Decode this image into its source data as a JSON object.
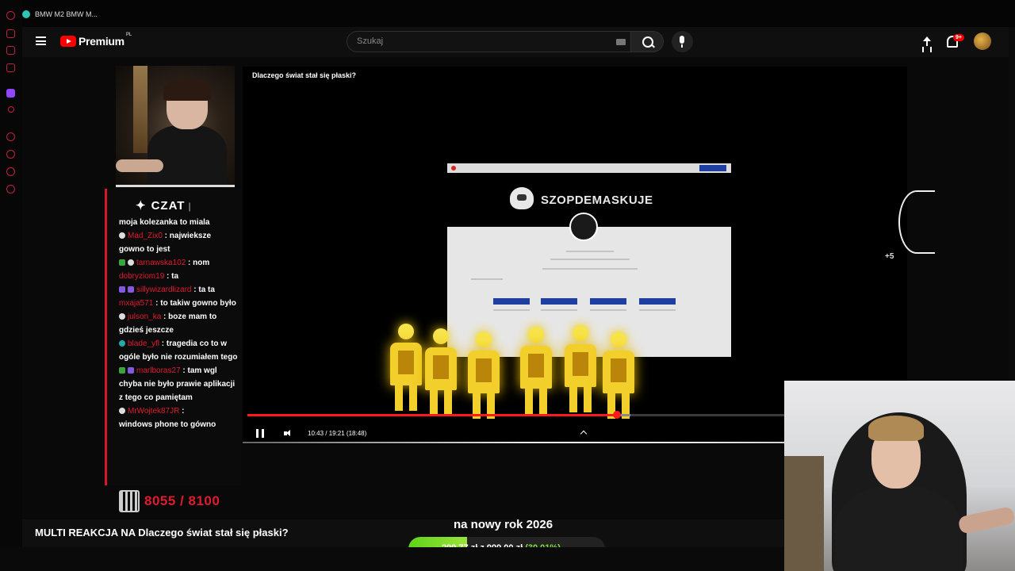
{
  "browser": {
    "tab_title": "BMW M2 BMW M..."
  },
  "header": {
    "brand": "Premium",
    "region": "PL",
    "search_placeholder": "Szukaj",
    "notification_badge": "9+"
  },
  "chat": {
    "title": "CZAT",
    "cursor": "|",
    "messages": [
      {
        "user": "",
        "text": "moja kolezanka to miala",
        "badges": []
      },
      {
        "user": "Mad_Zix0",
        "text": "najwieksze gowno to jest",
        "badges": [
          "w"
        ]
      },
      {
        "user": "tarnawska102",
        "text": "nom",
        "badges": [
          "g",
          "w"
        ]
      },
      {
        "user": "dobryziom19",
        "text": "ta",
        "badges": []
      },
      {
        "user": "sillywizardlizard",
        "text": "ta ta",
        "badges": [
          "p",
          "p"
        ]
      },
      {
        "user": "mxaja571",
        "text": "to takiw gowno było",
        "badges": []
      },
      {
        "user": "julson_ka",
        "text": "boze mam to gdzieś jeszcze",
        "badges": [
          "w"
        ]
      },
      {
        "user": "blade_yfl",
        "text": "tragedia co to w ogóle było nie rozumiałem tego",
        "badges": [
          "t"
        ]
      },
      {
        "user": "marlboras27",
        "text": "tam wgl chyba nie było prawie aplikacji z tego co pamiętam",
        "badges": [
          "g",
          "p"
        ]
      },
      {
        "user": "MrWojtek87JR",
        "text": "",
        "badges": [
          "w"
        ]
      },
      {
        "user": "",
        "text": "windows phone to gówno",
        "badges": []
      }
    ]
  },
  "sub_counter": {
    "text": "8055 / 8100"
  },
  "video": {
    "title": "Dlaczego świat stał się płaski?",
    "site_name": "SZOPDEMASKUJE",
    "time": "10:43 / 19:21 (18:48)",
    "progress": 0.56,
    "buffered": 0.58,
    "skip_label": "+5"
  },
  "bottom": {
    "stream_title": "MULTI REAKCJA NA Dlaczego świat stał się płaski?",
    "goal_title": "na nowy rok 2026",
    "goal_current": "299,77 zł",
    "goal_sep": "z",
    "goal_target": "999,00 zł",
    "goal_pct": "(30.01%)",
    "goal_fraction": 0.3001
  },
  "colors": {
    "accent": "#e01a2f",
    "youtube_red": "#ff0000",
    "goal_green": "#7ee13a",
    "figure_yellow": "#f3cf2c"
  }
}
